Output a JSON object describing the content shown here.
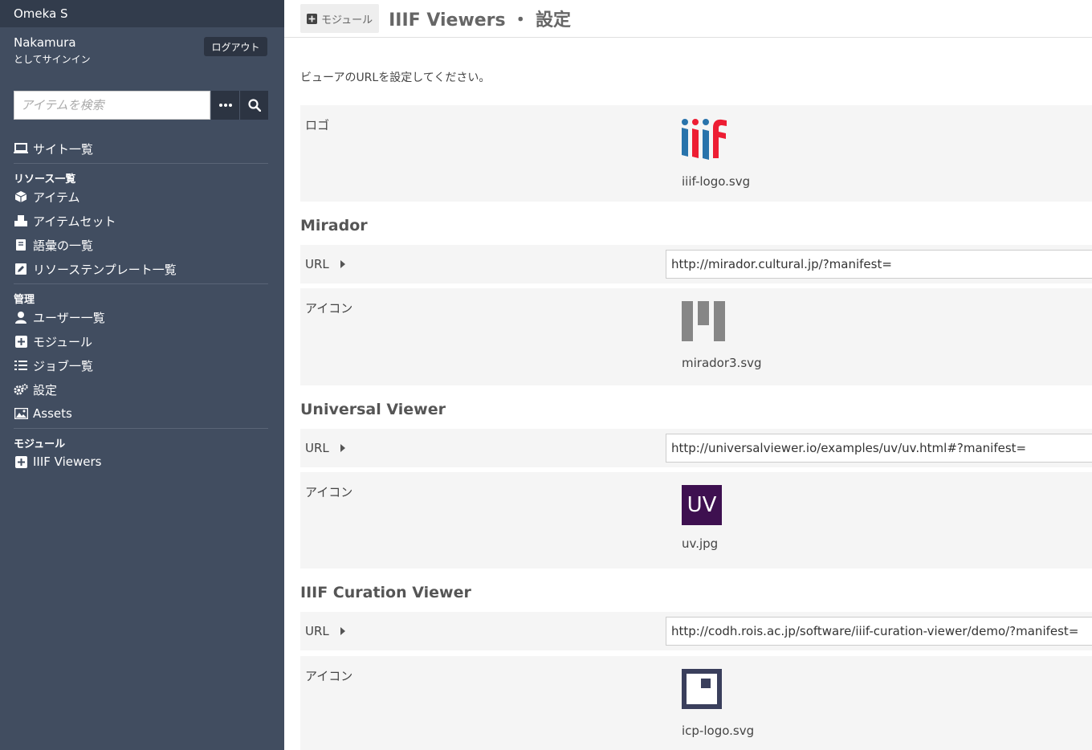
{
  "brand": "Omeka S",
  "user": {
    "name": "Nakamura",
    "subtitle": "としてサインイン",
    "logout_label": "ログアウト"
  },
  "search": {
    "placeholder": "アイテムを検索"
  },
  "nav": {
    "sites": "サイト一覧",
    "resources_heading": "リソース一覧",
    "items": "アイテム",
    "item_sets": "アイテムセット",
    "vocabularies": "語彙の一覧",
    "resource_templates": "リソーステンプレート一覧",
    "admin_heading": "管理",
    "users": "ユーザー一覧",
    "modules": "モジュール",
    "jobs": "ジョブ一覧",
    "settings": "設定",
    "assets": "Assets",
    "module_heading": "モジュール",
    "iiif_viewers": "IIIF Viewers"
  },
  "header": {
    "breadcrumb": "モジュール",
    "title": "IIIF Viewers ・ 設定"
  },
  "intro": "ビューアのURLを設定してください。",
  "logo_panel": {
    "label": "ロゴ",
    "file": "iiif-logo.svg"
  },
  "viewers": [
    {
      "name": "Mirador",
      "url_label": "URL",
      "url": "http://mirador.cultural.jp/?manifest=",
      "icon_label": "アイコン",
      "icon_file": "mirador3.svg"
    },
    {
      "name": "Universal Viewer",
      "url_label": "URL",
      "url": "http://universalviewer.io/examples/uv/uv.html#?manifest=",
      "icon_label": "アイコン",
      "icon_file": "uv.jpg",
      "icon_text": "UV"
    },
    {
      "name": "IIIF Curation Viewer",
      "url_label": "URL",
      "url": "http://codh.rois.ac.jp/software/iiif-curation-viewer/demo/?manifest=",
      "icon_label": "アイコン",
      "icon_file": "icp-logo.svg"
    }
  ],
  "colors": {
    "sidebar": "#414d60",
    "sidebar_dark": "#323c4c",
    "uv_purple": "#3e1050",
    "icp_navy": "#3a3f5c",
    "iiif_blue": "#2873ab",
    "iiif_red": "#ed1d33"
  }
}
